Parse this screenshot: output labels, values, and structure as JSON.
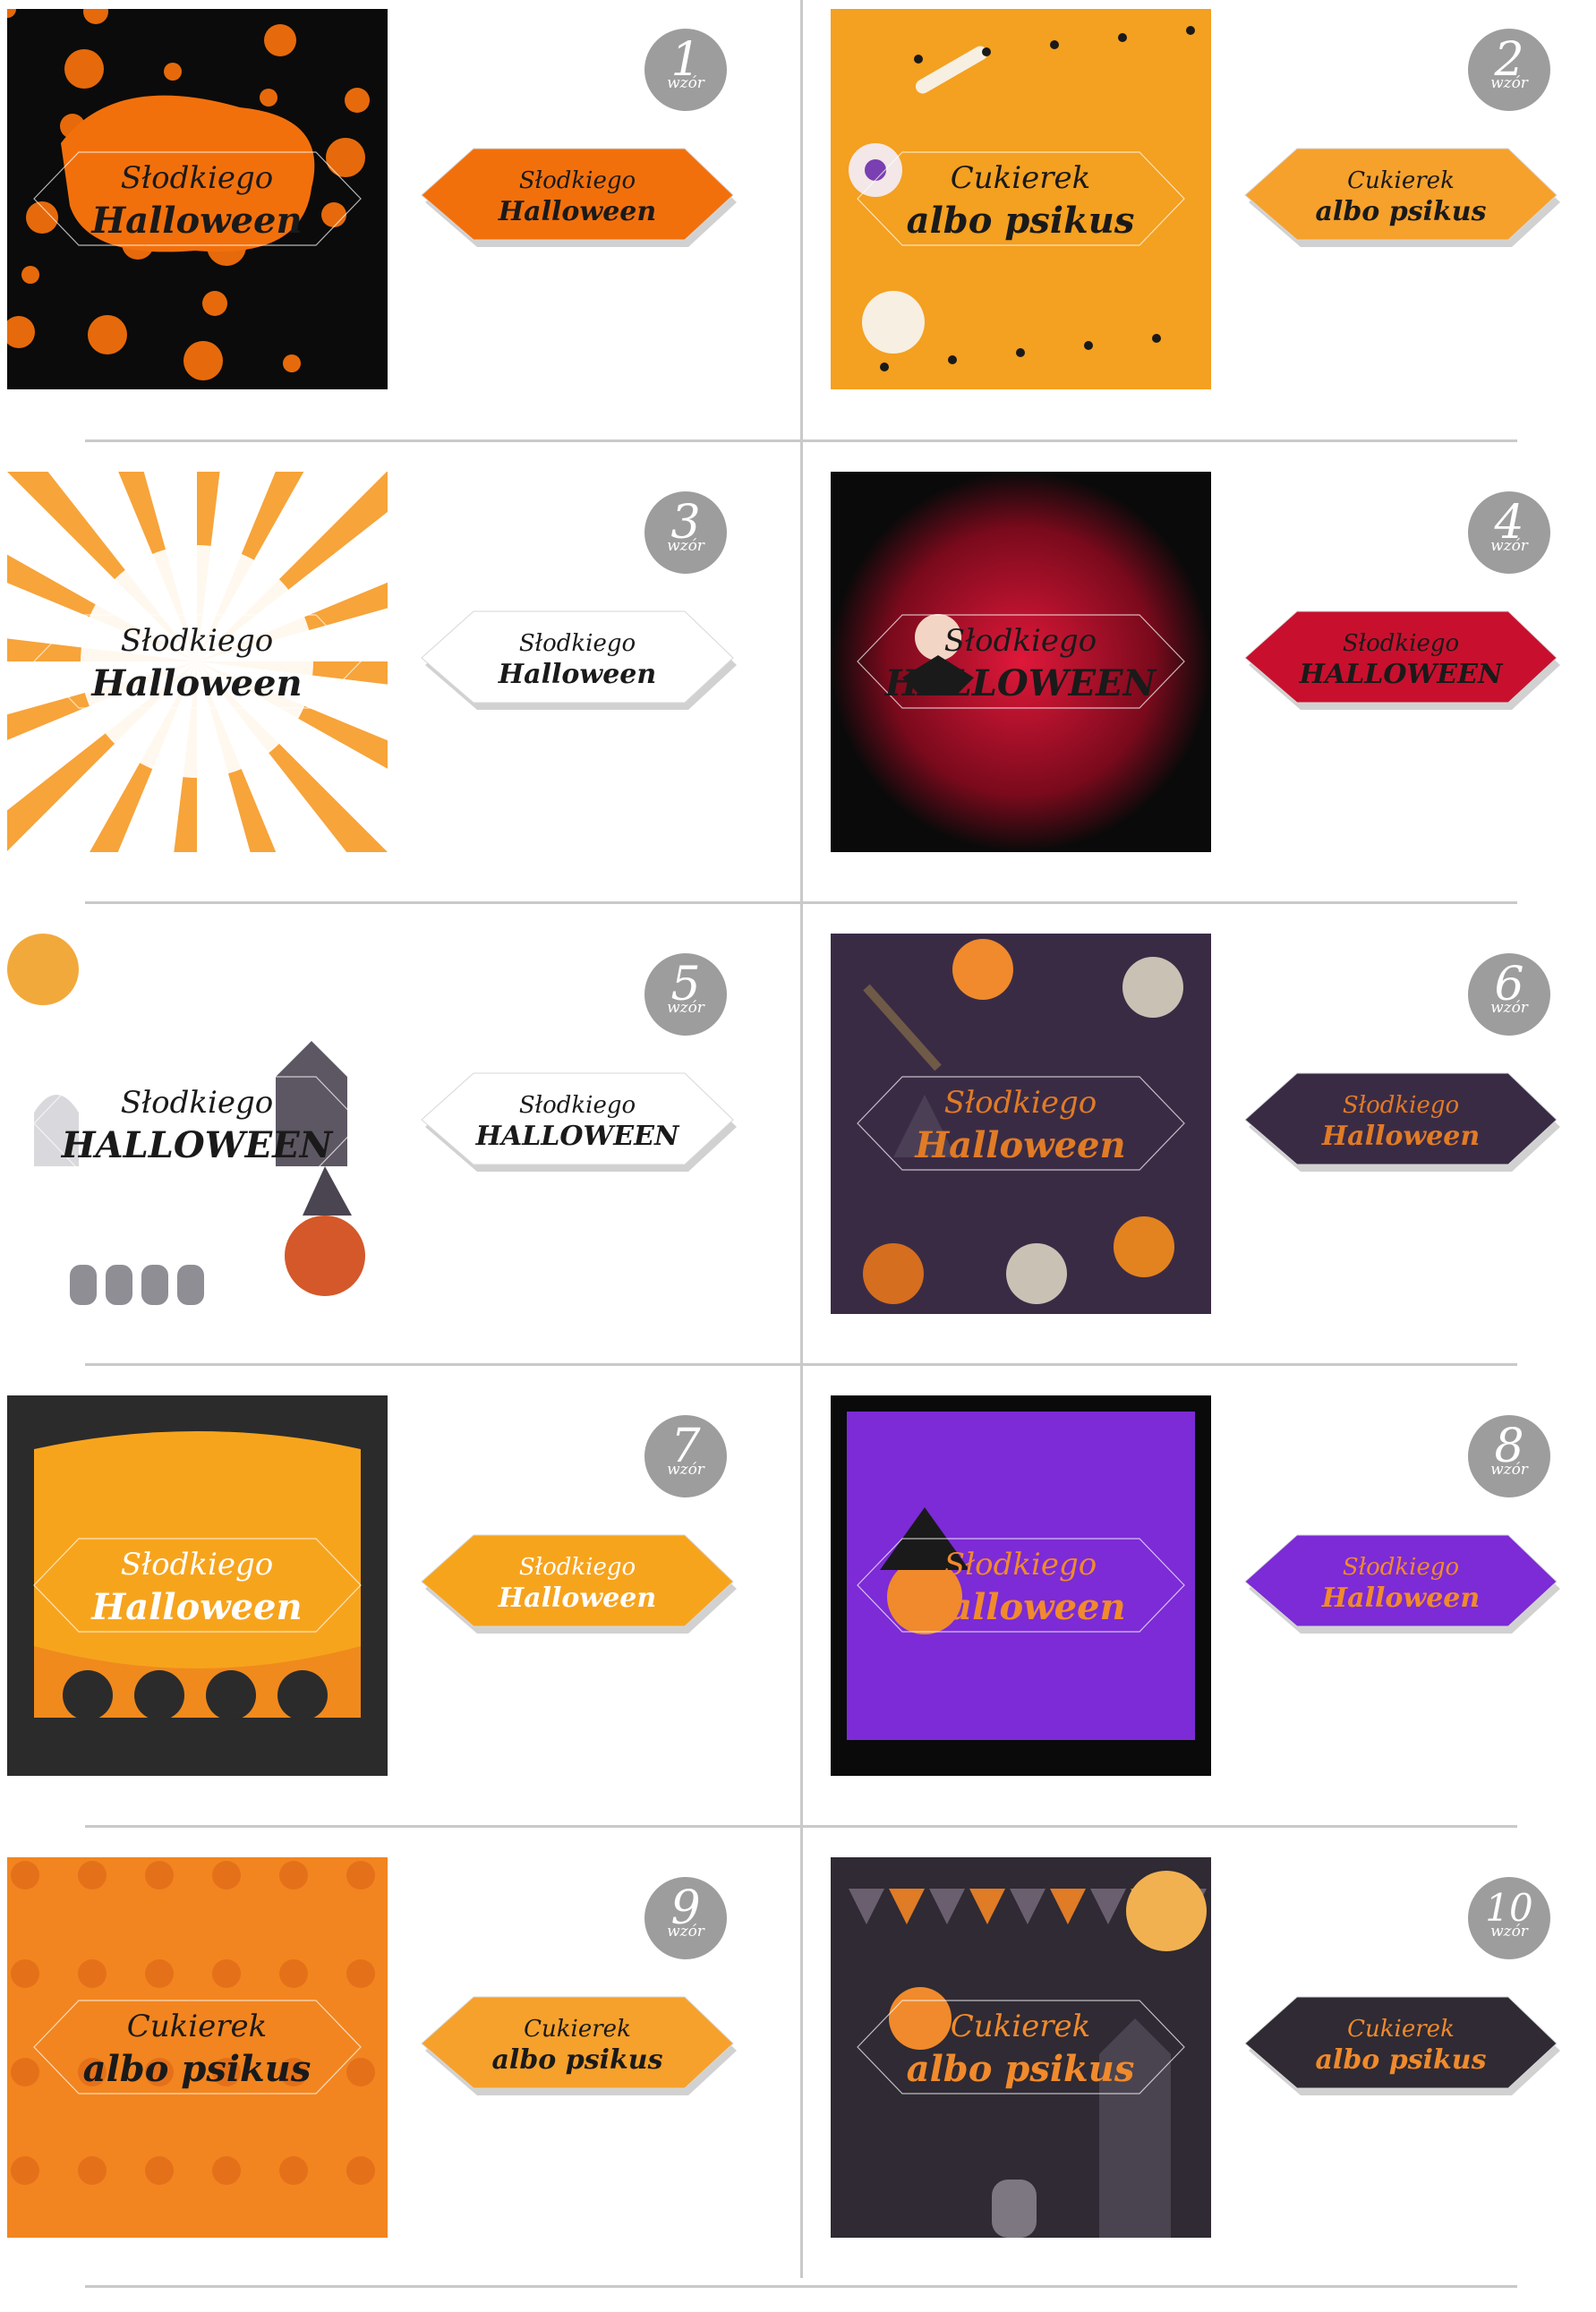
{
  "designs": [
    {
      "number": "1",
      "label": "wzór",
      "line1": "Słodkiego",
      "line2": "Halloween",
      "bg": "#0b0b0b",
      "accent": "#f2700c",
      "ink": "#1a1a1a",
      "theme": "black-orange"
    },
    {
      "number": "2",
      "label": "wzór",
      "line1": "Cukierek",
      "line2": "albo psikus",
      "bg": "#f4a020",
      "accent": "#ffffff",
      "ink": "#1a1a1a",
      "theme": "orange-candy"
    },
    {
      "number": "3",
      "label": "wzór",
      "line1": "Słodkiego",
      "line2": "Halloween",
      "bg": "#ffffff",
      "accent": "#f59a1c",
      "ink": "#1a1a1a",
      "theme": "white-rays"
    },
    {
      "number": "4",
      "label": "wzór",
      "line1": "Słodkiego",
      "line2": "HALLOWEEN",
      "bg": "#0a0a0a",
      "accent": "#c8102e",
      "ink": "#1a1a1a",
      "theme": "red-vampire"
    },
    {
      "number": "5",
      "label": "wzór",
      "line1": "Słodkiego",
      "line2": "HALLOWEEN",
      "bg": "#ffffff",
      "accent": "#8a8a8a",
      "ink": "#1a1a1a",
      "theme": "white-watercolor"
    },
    {
      "number": "6",
      "label": "wzór",
      "line1": "Słodkiego",
      "line2": "Halloween",
      "bg": "#3a2b45",
      "accent": "#e07b26",
      "ink": "#e07b26",
      "theme": "purple-watercolor"
    },
    {
      "number": "7",
      "label": "wzór",
      "line1": "Słodkiego",
      "line2": "Halloween",
      "bg": "#2b2b2b",
      "accent": "#f7a41d",
      "ink": "#ffffff",
      "theme": "black-orange-swirl"
    },
    {
      "number": "8",
      "label": "wzór",
      "line1": "Słodkiego",
      "line2": "Halloween",
      "bg": "#0a0a0a",
      "accent": "#7c2bd6",
      "ink": "#f08a2c",
      "theme": "purple-witch"
    },
    {
      "number": "9",
      "label": "wzór",
      "line1": "Cukierek",
      "line2": "albo psikus",
      "bg": "#f2851f",
      "accent": "#e5701a",
      "ink": "#1a1a1a",
      "theme": "orange-skulls"
    },
    {
      "number": "10",
      "label": "wzór",
      "line1": "Cukierek",
      "line2": "albo psikus",
      "bg": "#2f2a33",
      "accent": "#f08a2c",
      "ink": "#f08a2c",
      "theme": "dark-haunted"
    }
  ]
}
